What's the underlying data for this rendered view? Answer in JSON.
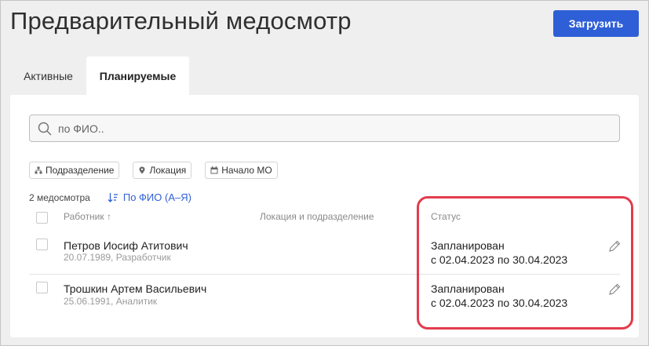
{
  "header": {
    "title": "Предварительный медосмотр",
    "upload_label": "Загрузить"
  },
  "tabs": [
    {
      "label": "Активные",
      "active": false
    },
    {
      "label": "Планируемые",
      "active": true
    }
  ],
  "search": {
    "placeholder": "по ФИО..",
    "value": ""
  },
  "filters": [
    {
      "label": "Подразделение",
      "icon": "hierarchy-icon"
    },
    {
      "label": "Локация",
      "icon": "location-pin-icon"
    },
    {
      "label": "Начало МО",
      "icon": "calendar-icon"
    }
  ],
  "list": {
    "count_label": "2 медосмотра",
    "sort_label": "По ФИО (А–Я)",
    "columns": {
      "worker": "Работник",
      "worker_sort_arrow": "↑",
      "location": "Локация и подразделение",
      "status": "Статус"
    },
    "rows": [
      {
        "name": "Петров Иосиф Атитович",
        "details": "20.07.1989, Разработчик",
        "status": "Запланирован",
        "period": "с 02.04.2023 по 30.04.2023"
      },
      {
        "name": "Трошкин Артем Васильевич",
        "details": "25.06.1991, Аналитик",
        "status": "Запланирован",
        "period": "с 02.04.2023 по 30.04.2023"
      }
    ]
  },
  "colors": {
    "accent": "#2f5fd6",
    "highlight": "#e23c4d",
    "background": "#efefef"
  }
}
